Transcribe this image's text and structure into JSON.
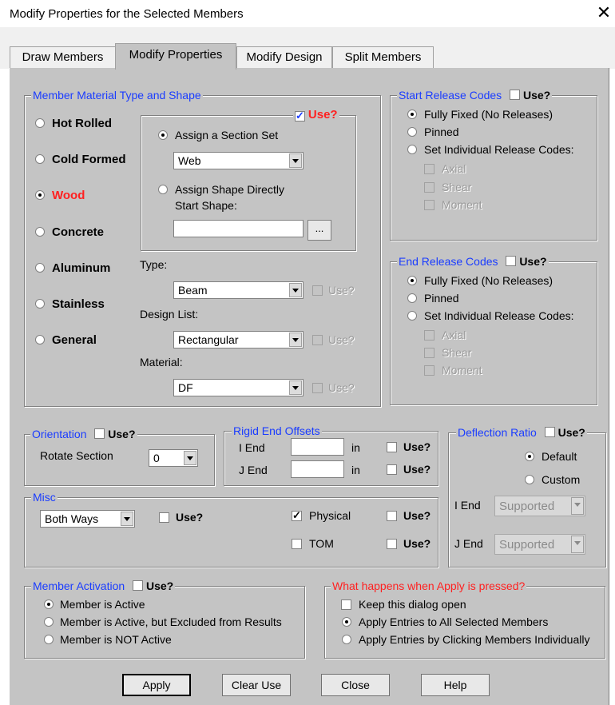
{
  "window": {
    "title": "Modify Properties for the Selected Members",
    "close": "✕"
  },
  "tabs": [
    "Draw Members",
    "Modify Properties",
    "Modify Design",
    "Split Members"
  ],
  "active_tab": "Modify Properties",
  "material": {
    "legend": "Member Material Type and Shape",
    "use_label": "Use?",
    "options": [
      "Hot Rolled",
      "Cold Formed",
      "Wood",
      "Concrete",
      "Aluminum",
      "Stainless",
      "General"
    ],
    "selected": "Wood",
    "assign_section": "Assign a Section Set",
    "section_value": "Web",
    "assign_shape": "Assign Shape Directly",
    "start_shape": "Start Shape:",
    "browse": "...",
    "type_label": "Type:",
    "type_value": "Beam",
    "design_list_label": "Design List:",
    "design_list_value": "Rectangular",
    "material_label": "Material:",
    "material_value": "DF",
    "small_use": "Use?"
  },
  "start_release": {
    "legend": "Start Release Codes",
    "use": "Use?",
    "options": [
      "Fully Fixed (No Releases)",
      "Pinned",
      "Set Individual Release Codes:"
    ],
    "codes": [
      "Axial",
      "Shear",
      "Moment"
    ]
  },
  "end_release": {
    "legend": "End Release Codes",
    "use": "Use?",
    "options": [
      "Fully Fixed (No Releases)",
      "Pinned",
      "Set Individual Release Codes:"
    ],
    "codes": [
      "Axial",
      "Shear",
      "Moment"
    ]
  },
  "orientation": {
    "legend": "Orientation",
    "use": "Use?",
    "rotate_label": "Rotate Section",
    "rotate_value": "0"
  },
  "rigid": {
    "legend": "Rigid End Offsets",
    "i_end": "I End",
    "j_end": "J End",
    "unit": "in",
    "use": "Use?"
  },
  "deflection": {
    "legend": "Deflection Ratio",
    "use": "Use?",
    "default": "Default",
    "custom": "Custom",
    "i_end": "I End",
    "j_end": "J End",
    "i_value": "Supported",
    "j_value": "Supported"
  },
  "misc": {
    "legend": "Misc",
    "dir_value": "Both Ways",
    "use": "Use?",
    "physical": "Physical",
    "tom": "TOM"
  },
  "activation": {
    "legend": "Member Activation",
    "use": "Use?",
    "options": [
      "Member is Active",
      "Member is Active, but Excluded from Results",
      "Member is NOT Active"
    ]
  },
  "apply_group": {
    "legend": "What happens when Apply is pressed?",
    "keep_open": "Keep this dialog open",
    "options": [
      "Apply Entries to All Selected Members",
      "Apply Entries by Clicking Members Individually"
    ]
  },
  "buttons": {
    "apply": "Apply",
    "clear": "Clear Use",
    "close": "Close",
    "help": "Help"
  }
}
